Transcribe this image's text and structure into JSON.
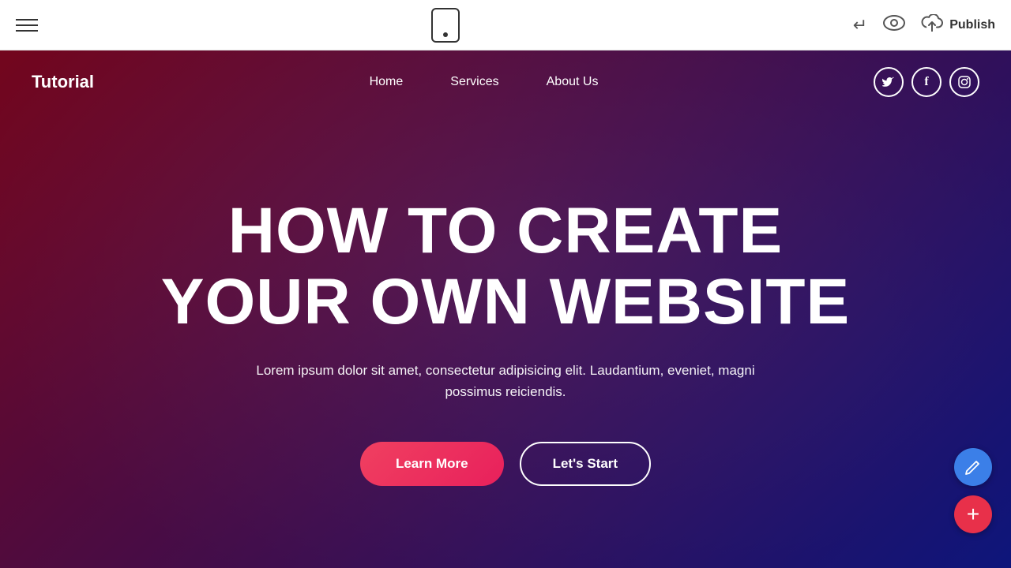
{
  "toolbar": {
    "hamburger_label": "menu",
    "undo_symbol": "↩",
    "eye_symbol": "◎",
    "publish_label": "Publish",
    "cloud_symbol": "⬆"
  },
  "site": {
    "logo": "Tutorial",
    "nav_links": [
      {
        "label": "Home",
        "href": "#"
      },
      {
        "label": "Services",
        "href": "#"
      },
      {
        "label": "About Us",
        "href": "#"
      }
    ],
    "social": [
      {
        "label": "T",
        "name": "twitter"
      },
      {
        "label": "f",
        "name": "facebook"
      },
      {
        "label": "in",
        "name": "instagram"
      }
    ]
  },
  "hero": {
    "title_line1": "HOW TO CREATE",
    "title_line2": "YOUR OWN WEBSITE",
    "subtitle": "Lorem ipsum dolor sit amet, consectetur adipisicing elit. Laudantium, eveniet, magni possimus reiciendis.",
    "btn_learn_more": "Learn More",
    "btn_lets_start": "Let's Start"
  },
  "fab": {
    "pencil_icon": "✎",
    "plus_icon": "+"
  }
}
